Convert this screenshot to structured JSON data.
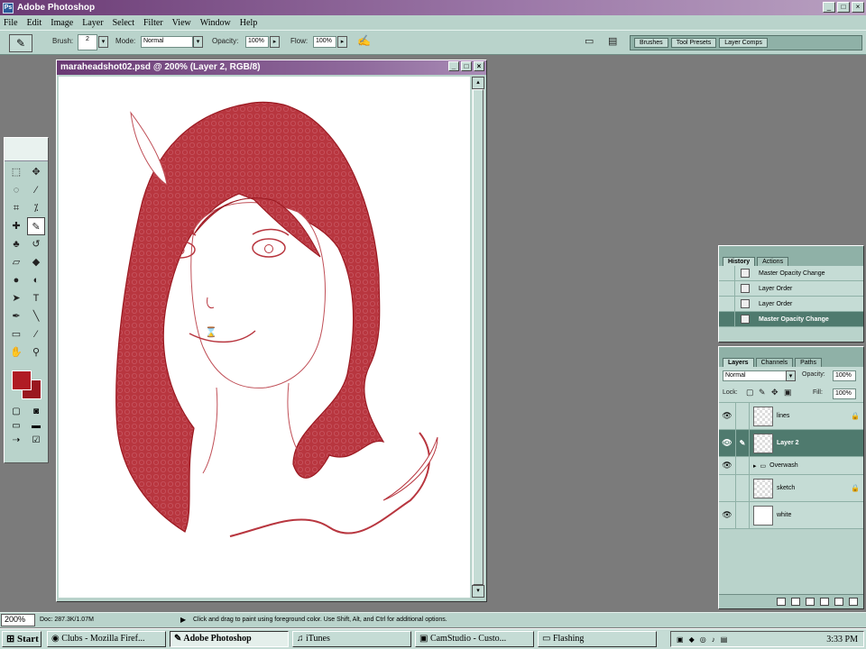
{
  "app": {
    "title": "Adobe Photoshop"
  },
  "menu": [
    "File",
    "Edit",
    "Image",
    "Layer",
    "Select",
    "Filter",
    "View",
    "Window",
    "Help"
  ],
  "options": {
    "brush_label": "Brush:",
    "brush_size": "2",
    "mode_label": "Mode:",
    "mode_value": "Normal",
    "opacity_label": "Opacity:",
    "opacity_value": "100%",
    "flow_label": "Flow:",
    "flow_value": "100%"
  },
  "palette_well": {
    "tabs": [
      "Brushes",
      "Tool Presets",
      "Layer Comps"
    ]
  },
  "document": {
    "title": "maraheadshot02.psd @ 200% (Layer 2, RGB/8)"
  },
  "colors": {
    "foreground": "#b01c24",
    "background": "#9a1820",
    "accent": "#6a3a74"
  },
  "history": {
    "tabs": [
      "History",
      "Actions"
    ],
    "items": [
      {
        "label": "Master Opacity Change"
      },
      {
        "label": "Layer Order"
      },
      {
        "label": "Layer Order"
      },
      {
        "label": "Master Opacity Change"
      }
    ]
  },
  "layers": {
    "tabs": [
      "Layers",
      "Channels",
      "Paths"
    ],
    "blend_mode": "Normal",
    "opacity_label": "Opacity:",
    "opacity_value": "100%",
    "lock_label": "Lock:",
    "fill_label": "Fill:",
    "fill_value": "100%",
    "items": [
      {
        "name": "lines"
      },
      {
        "name": "Layer 2"
      },
      {
        "name": "Overwash"
      },
      {
        "name": "sketch"
      },
      {
        "name": "white"
      }
    ]
  },
  "status": {
    "zoom": "200%",
    "doc": "Doc: 287.3K/1.07M",
    "hint": "Click and drag to paint using foreground color.  Use Shift, Alt, and Ctrl for additional options."
  },
  "taskbar": {
    "start": "Start",
    "items": [
      "Clubs - Mozilla Firef...",
      "Adobe Photoshop",
      "iTunes",
      "CamStudio - Custo...",
      "Flashing"
    ],
    "clock": "3:33 PM"
  }
}
